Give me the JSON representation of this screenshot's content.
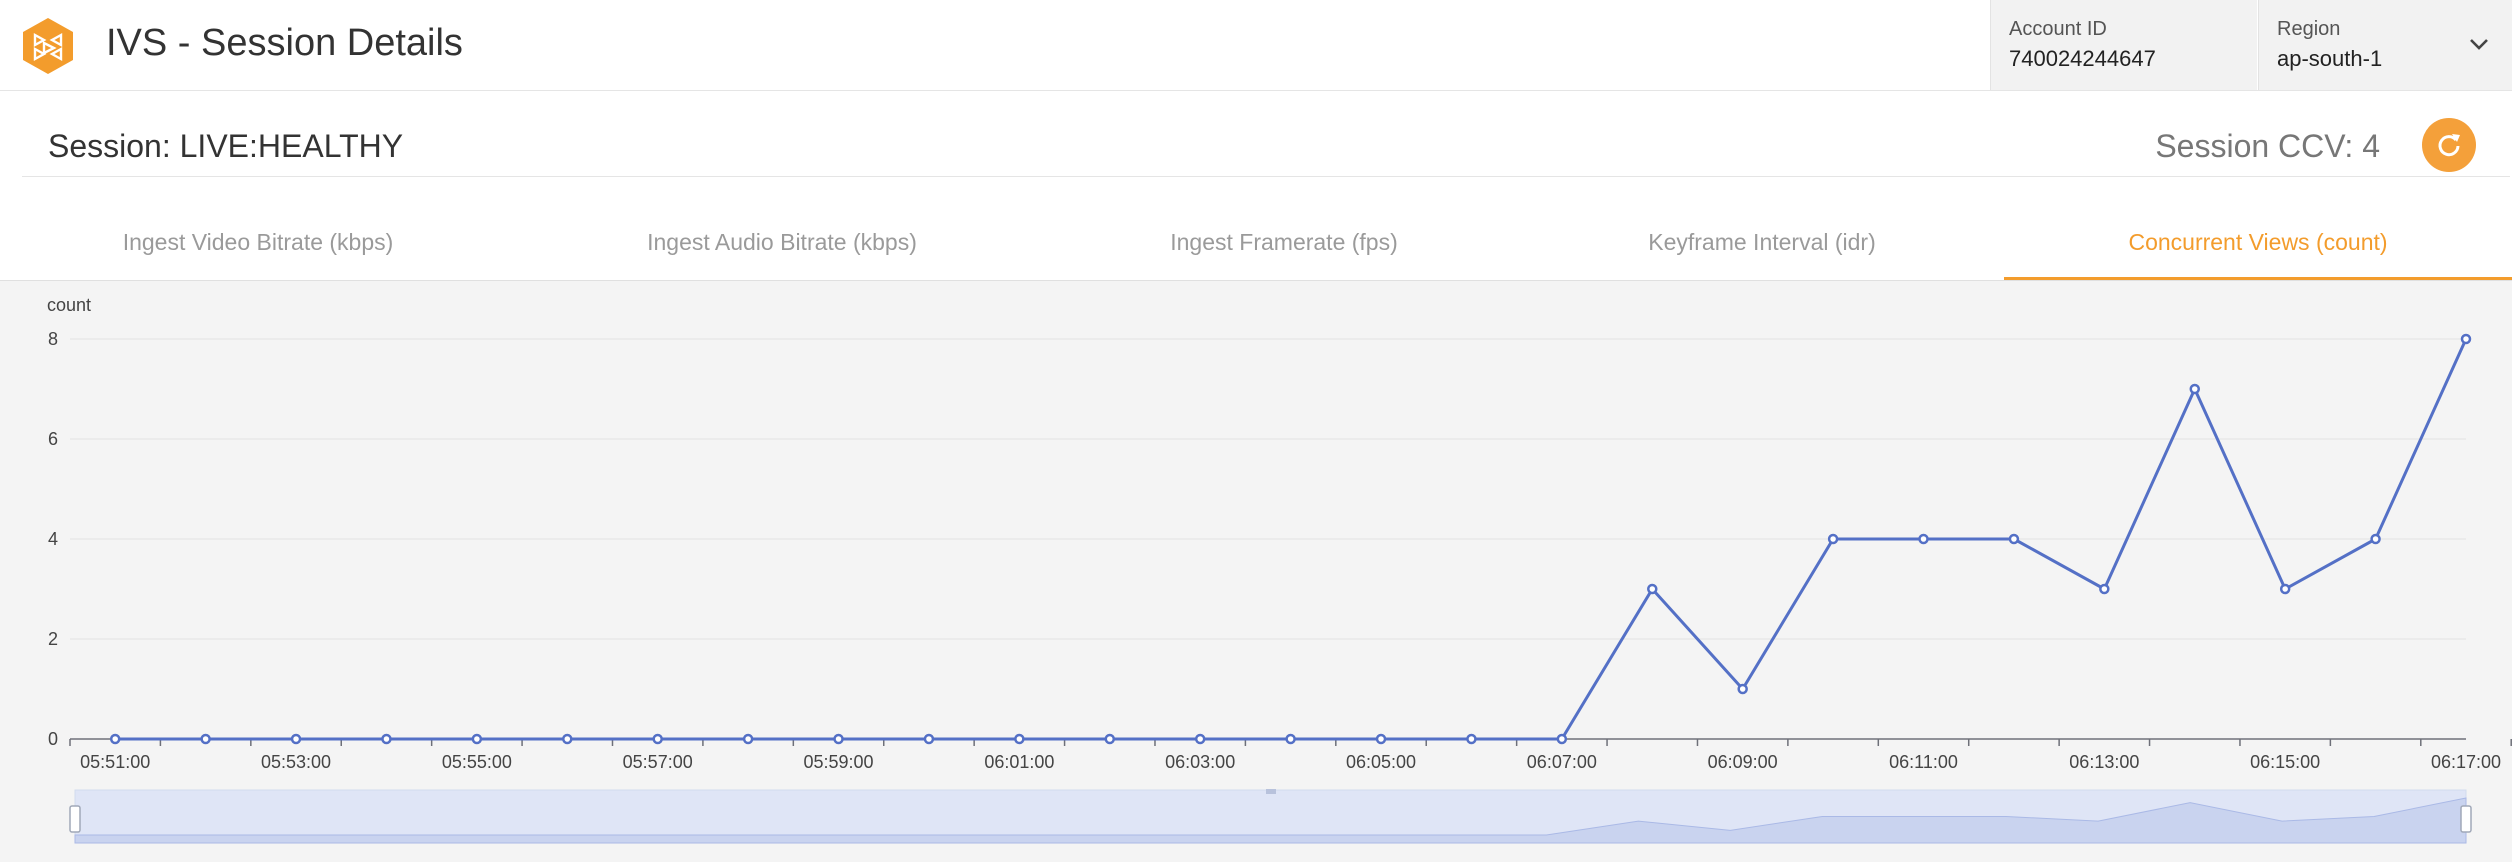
{
  "header": {
    "app_title": "IVS - Session Details",
    "logo_icon": "hexagon-play-logo-icon",
    "account": {
      "label": "Account ID",
      "value": "740024244647"
    },
    "region": {
      "label": "Region",
      "value": "ap-south-1"
    }
  },
  "session": {
    "title": "Session: LIVE:HEALTHY",
    "ccv": "Session CCV: 4",
    "refresh_icon": "refresh-icon"
  },
  "tabs": [
    {
      "label": "Ingest Video Bitrate (kbps)",
      "active": false
    },
    {
      "label": "Ingest Audio Bitrate (kbps)",
      "active": false
    },
    {
      "label": "Ingest Framerate (fps)",
      "active": false
    },
    {
      "label": "Keyframe Interval (idr)",
      "active": false
    },
    {
      "label": "Concurrent Views (count)",
      "active": true
    }
  ],
  "colors": {
    "accent": "#f39c2c",
    "series": "#5470c6",
    "slider_fill": "#dfe5f6"
  },
  "chart_data": {
    "type": "line",
    "ylabel": "count",
    "ylim": [
      0,
      8
    ],
    "yticks": [
      0,
      2,
      4,
      6,
      8
    ],
    "x": [
      "05:51:00",
      "05:52:00",
      "05:53:00",
      "05:54:00",
      "05:55:00",
      "05:56:00",
      "05:57:00",
      "05:58:00",
      "05:59:00",
      "06:00:00",
      "06:01:00",
      "06:02:00",
      "06:03:00",
      "06:04:00",
      "06:05:00",
      "06:06:00",
      "06:07:00",
      "06:08:00",
      "06:09:00",
      "06:10:00",
      "06:11:00",
      "06:12:00",
      "06:13:00",
      "06:14:00",
      "06:15:00",
      "06:16:00",
      "06:17:00"
    ],
    "xtick_labels": [
      "05:51:00",
      "05:53:00",
      "05:55:00",
      "05:57:00",
      "05:59:00",
      "06:01:00",
      "06:03:00",
      "06:05:00",
      "06:07:00",
      "06:09:00",
      "06:11:00",
      "06:13:00",
      "06:15:00",
      "06:17:00"
    ],
    "series": [
      {
        "values": [
          0,
          0,
          0,
          0,
          0,
          0,
          0,
          0,
          0,
          0,
          0,
          0,
          0,
          0,
          0,
          0,
          0,
          3,
          1,
          4,
          4,
          4,
          3,
          7,
          3,
          4,
          8
        ]
      }
    ],
    "grid": true,
    "data_zoom_slider": true
  }
}
